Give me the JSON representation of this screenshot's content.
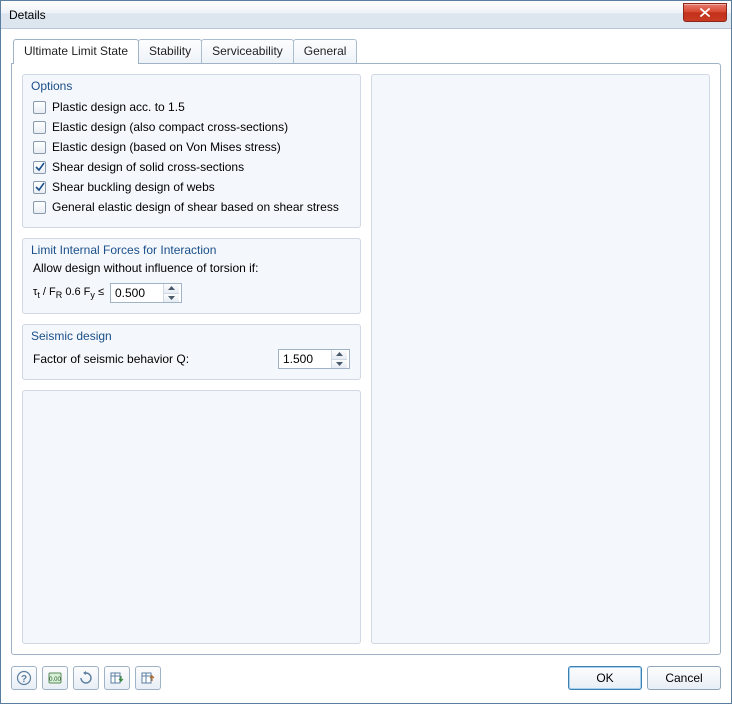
{
  "window": {
    "title": "Details"
  },
  "tabs": [
    {
      "label": "Ultimate Limit State",
      "active": true
    },
    {
      "label": "Stability",
      "active": false
    },
    {
      "label": "Serviceability",
      "active": false
    },
    {
      "label": "General",
      "active": false
    }
  ],
  "options": {
    "legend": "Options",
    "items": [
      {
        "label": "Plastic design acc. to 1.5",
        "checked": false
      },
      {
        "label": "Elastic design (also compact cross-sections)",
        "checked": false
      },
      {
        "label": "Elastic design (based on Von Mises stress)",
        "checked": false
      },
      {
        "label": "Shear design of solid cross-sections",
        "checked": true
      },
      {
        "label": "Shear buckling design of webs",
        "checked": true
      },
      {
        "label": "General elastic design of shear based on shear stress",
        "checked": false
      }
    ]
  },
  "limit": {
    "legend": "Limit Internal Forces for Interaction",
    "intro": "Allow design without influence of torsion if:",
    "formula_prefix": "τ",
    "formula_sub1": "t",
    "formula_mid": " / F",
    "formula_sub2": "R",
    "formula_mid2": " 0.6 F",
    "formula_sub3": "y",
    "formula_suffix": "  ≤",
    "value": "0.500"
  },
  "seismic": {
    "legend": "Seismic design",
    "label": "Factor of seismic behavior Q:",
    "value": "1.500"
  },
  "footer": {
    "ok": "OK",
    "cancel": "Cancel"
  }
}
